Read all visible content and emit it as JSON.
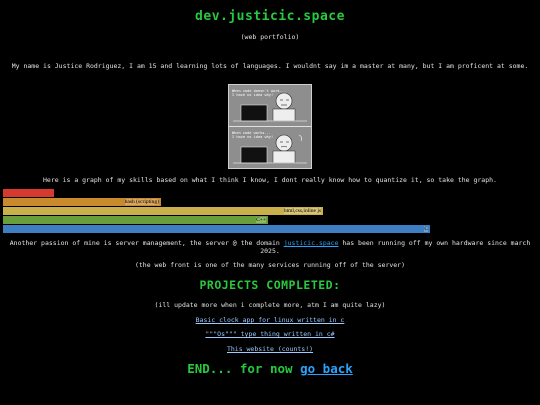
{
  "header": {
    "title": "dev.justicic.space",
    "subtitle": "(web portfolio)"
  },
  "intro": "My name is Justice Rodriguez, I am 15 and learning lots of languages. I wouldnt say im a master at many, but I am proficent at some.",
  "comic": {
    "top_caption": "When code doesn't work...\nI have no idea why!",
    "bottom_caption": "When code works...\nI have no idea why!"
  },
  "skills_intro": "Here is a graph of my skills based on what I think I know, I dont really know how to quantize it, so take the graph.",
  "chart_data": {
    "type": "bar",
    "orientation": "horizontal",
    "categories": [
      "",
      "bash (scripting)",
      "html,css,inline js",
      "C++",
      "C"
    ],
    "values": [
      12,
      37,
      75,
      62,
      100
    ],
    "colors": [
      "#d63a2f",
      "#c98a2e",
      "#c9b04a",
      "#6a9e3a",
      "#3d7fc2"
    ],
    "title": "",
    "xlabel": "",
    "ylabel": ""
  },
  "server": {
    "text_before": "Another passion of mine is server management, the server @ the domain ",
    "link": "justicic.space",
    "text_after": " has been running off my own hardware since march 2025."
  },
  "webfront": "(the web front is one of the many services running off of the server)",
  "projects": {
    "heading": "PROJECTS COMPLETED:",
    "note": "(ill update more when i complete more, atm I am quite lazy)",
    "items": [
      "Basic clock app for linux written in c",
      "\"\"\"Os\"\"\" type thing written in c#",
      "This website (counts!)"
    ]
  },
  "footer": {
    "end_text": "END... for now ",
    "back_link": "go back"
  }
}
